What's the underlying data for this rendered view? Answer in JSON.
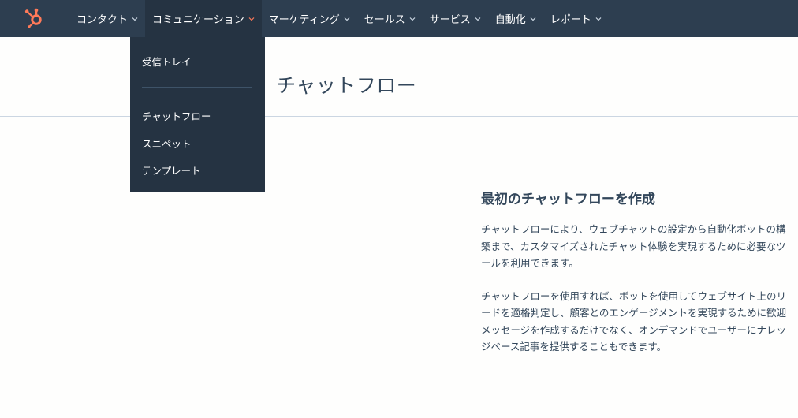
{
  "topnav": {
    "items": [
      {
        "label": "コンタクト"
      },
      {
        "label": "コミュニケーション"
      },
      {
        "label": "マーケティング"
      },
      {
        "label": "セールス"
      },
      {
        "label": "サービス"
      },
      {
        "label": "自動化"
      },
      {
        "label": "レポート"
      }
    ]
  },
  "dropdown": {
    "items": [
      {
        "label": "受信トレイ"
      },
      {
        "label": "チャットフロー"
      },
      {
        "label": "スニペット"
      },
      {
        "label": "テンプレート"
      }
    ]
  },
  "page": {
    "title": "チャットフロー"
  },
  "empty_state": {
    "heading": "最初のチャットフローを作成",
    "paragraph1": "チャットフローにより、ウェブチャットの設定から自動化ボットの構築まで、カスタマイズされたチャット体験を実現するために必要なツールを利用できます。",
    "paragraph2": "チャットフローを使用すれば、ボットを使用してウェブサイト上のリードを適格判定し、顧客とのエンゲージメントを実現するために歓迎メッセージを作成するだけでなく、オンデマンドでユーザーにナレッジベース記事を提供することもできます。"
  },
  "colors": {
    "nav_bg": "#2d3e50",
    "dropdown_bg": "#253342",
    "accent": "#ff7a59",
    "text": "#33475b"
  }
}
